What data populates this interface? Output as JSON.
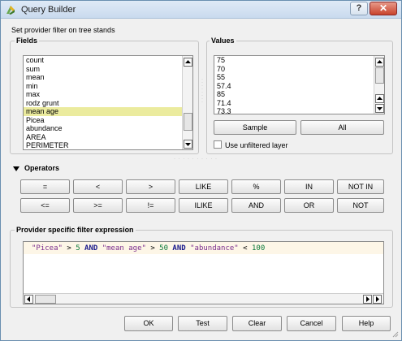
{
  "window": {
    "title": "Query Builder",
    "help_label": "?",
    "close_label": "✕"
  },
  "header": {
    "description": "Set provider filter on tree stands"
  },
  "fields": {
    "title": "Fields",
    "items": [
      "count",
      "sum",
      "mean",
      "min",
      "max",
      "rodz grunt",
      "mean age",
      "Picea",
      "abundance",
      "AREA",
      "PERIMETER"
    ],
    "selected": "mean age"
  },
  "values": {
    "title": "Values",
    "items": [
      "75",
      "70",
      "55",
      "57.4",
      "85",
      "71.4",
      "73.3"
    ],
    "sample_label": "Sample",
    "all_label": "All",
    "unfiltered_label": "Use unfiltered layer",
    "unfiltered_checked": false
  },
  "operators": {
    "title": "Operators",
    "row1": [
      "=",
      "<",
      ">",
      "LIKE",
      "%",
      "IN",
      "NOT IN"
    ],
    "row2": [
      "<=",
      ">=",
      "!=",
      "ILIKE",
      "AND",
      "OR",
      "NOT"
    ]
  },
  "expression": {
    "title": "Provider specific filter expression",
    "tokens": [
      {
        "text": "\"Picea\"",
        "kind": "field"
      },
      {
        "text": " > ",
        "kind": "op"
      },
      {
        "text": "5",
        "kind": "num"
      },
      {
        "text": " AND ",
        "kind": "kw"
      },
      {
        "text": "\"mean age\"",
        "kind": "field"
      },
      {
        "text": " > ",
        "kind": "op"
      },
      {
        "text": "50",
        "kind": "num"
      },
      {
        "text": " AND ",
        "kind": "kw"
      },
      {
        "text": "\"abundance\"",
        "kind": "field"
      },
      {
        "text": " < ",
        "kind": "op"
      },
      {
        "text": "100",
        "kind": "num"
      }
    ]
  },
  "buttons": {
    "ok": "OK",
    "test": "Test",
    "clear": "Clear",
    "cancel": "Cancel",
    "help": "Help"
  },
  "colors": {
    "selection": "#ebeb9e",
    "field_token": "#7b2d8e",
    "number_token": "#0b7a3a",
    "keyword_token": "#1a1a8c",
    "current_line": "#fdf6e7"
  },
  "icons": {
    "app": "qgis-icon",
    "help": "help-icon",
    "close": "close-icon",
    "collapse": "triangle-down-icon"
  }
}
